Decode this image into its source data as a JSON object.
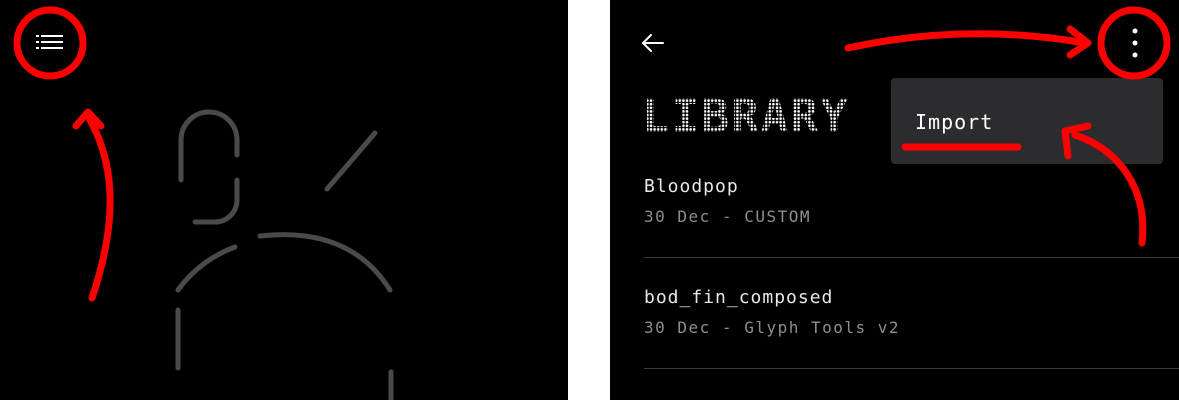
{
  "left": {
    "icons": {
      "menu": "list-menu-icon"
    }
  },
  "right": {
    "icons": {
      "back": "arrow-left-icon",
      "more": "more-vertical-icon"
    },
    "title": "LIBRARY",
    "menu": {
      "items": [
        {
          "label": "Import"
        }
      ]
    },
    "library_items": [
      {
        "name": "Bloodpop",
        "meta": "30 Dec - CUSTOM"
      },
      {
        "name": "bod_fin_composed",
        "meta": "30 Dec - Glyph Tools v2"
      }
    ]
  },
  "colors": {
    "background": "#000000",
    "annotation": "#ff0000",
    "menu_bg": "#2c2c2e",
    "secondary_text": "#8e8e8e",
    "glyph_stroke": "#4a4a4a"
  }
}
